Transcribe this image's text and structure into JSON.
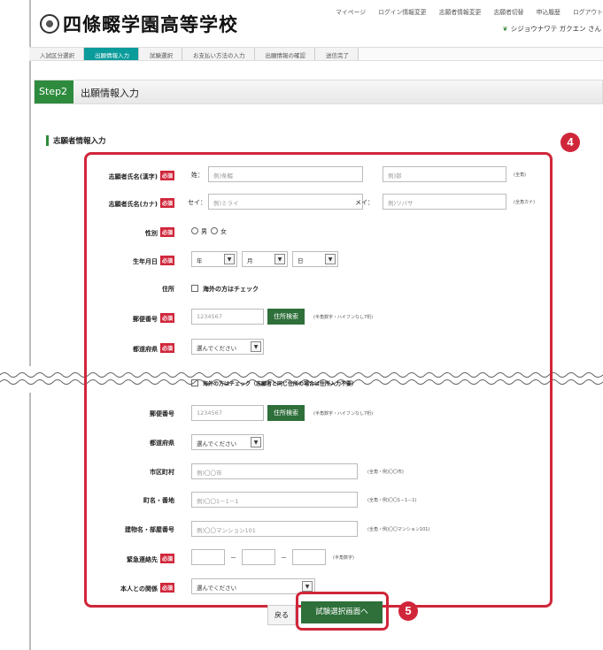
{
  "header": {
    "school_name": "四條畷学園高等学校",
    "nav": [
      "マイページ",
      "ログイン情報変更",
      "志願者情報変更",
      "志願者切替",
      "申込履歴",
      "ログアウト"
    ],
    "user": "シジョウナワテ ガクエン さん"
  },
  "steps": [
    "入試区分選択",
    "出願情報入力",
    "試験選択",
    "お支払い方法の入力",
    "出願情報の確認",
    "送信完了"
  ],
  "page": {
    "step_badge": "Step2",
    "title": "出願情報入力",
    "section_title": "志願者情報入力"
  },
  "markers": {
    "four": "4",
    "five": "5"
  },
  "required": "必須",
  "form": {
    "name_kanji": {
      "label": "志願者氏名(漢字)",
      "sei_label": "姓：",
      "sei_ph": "例)条畷",
      "mei_label": "名：",
      "mei_ph": "例)郎",
      "hint": "(全角)"
    },
    "name_kana": {
      "label": "志願者氏名(カナ)",
      "sei_label": "セイ：",
      "sei_ph": "例)ミライ",
      "mei_label": "メイ：",
      "mei_ph": "例)ツバサ",
      "hint": "(全角カナ)"
    },
    "gender": {
      "label": "性別",
      "male": "男",
      "female": "女"
    },
    "birth": {
      "label": "生年月日",
      "year": "年",
      "month": "月",
      "day": "日"
    },
    "address": {
      "label": "住所",
      "overseas": "海外の方はチェック",
      "overseas2": "海外の方はチェック（志願者と同じ住所の場合は住所入力不要）"
    },
    "postal": {
      "label": "郵便番号",
      "ph": "1234567",
      "button": "住所検索",
      "hint": "(半角数字・ハイフンなし7桁)"
    },
    "pref": {
      "label": "都道府県",
      "value": "選んでください"
    },
    "city": {
      "label": "市区町村",
      "ph": "例)〇〇市",
      "hint": "(全角・例)〇〇市)"
    },
    "town": {
      "label": "町名・番地",
      "ph": "例)〇〇1－1－1",
      "hint": "(全角・例)〇〇1－1－1)"
    },
    "building": {
      "label": "建物名・部屋番号",
      "ph": "例)〇〇マンション101",
      "hint": "(全角・例)〇〇マンション101)"
    },
    "phone": {
      "label": "緊急連絡先",
      "dash": "－",
      "hint": "(半角数字)"
    },
    "relation": {
      "label": "本人との関係",
      "value": "選んでください"
    }
  },
  "buttons": {
    "back": "戻る",
    "next": "試験選択画面へ"
  }
}
